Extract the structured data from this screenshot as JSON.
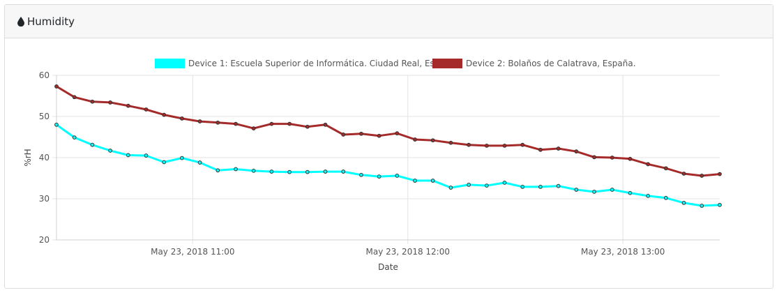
{
  "header": {
    "title": "Humidity",
    "icon": "droplet-icon"
  },
  "chart_data": {
    "type": "line",
    "title": "",
    "xlabel": "Date",
    "ylabel": "%rH",
    "ylim": [
      20,
      60
    ],
    "yticks": [
      "20",
      "30",
      "40",
      "50",
      "60"
    ],
    "xtick_labels": [
      "May 23, 2018 11:00",
      "May 23, 2018 12:00",
      "May 23, 2018 13:00"
    ],
    "grid": true,
    "legend_position": "top",
    "x": [
      "10:22",
      "10:27",
      "10:32",
      "10:37",
      "10:42",
      "10:47",
      "10:52",
      "10:57",
      "11:02",
      "11:07",
      "11:12",
      "11:17",
      "11:22",
      "11:27",
      "11:32",
      "11:37",
      "11:42",
      "11:47",
      "11:52",
      "11:57",
      "12:02",
      "12:07",
      "12:12",
      "12:17",
      "12:22",
      "12:27",
      "12:32",
      "12:37",
      "12:42",
      "12:47",
      "12:52",
      "12:57",
      "13:02",
      "13:07",
      "13:12",
      "13:17",
      "13:22",
      "13:27"
    ],
    "series": [
      {
        "name": "Device 1: Escuela Superior de Informática. Ciudad Real, España.",
        "color": "#00ffff",
        "values": [
          48.0,
          44.9,
          43.1,
          41.7,
          40.6,
          40.5,
          38.9,
          39.9,
          38.8,
          36.9,
          37.2,
          36.8,
          36.6,
          36.5,
          36.5,
          36.6,
          36.6,
          35.8,
          35.4,
          35.6,
          34.4,
          34.4,
          32.7,
          33.4,
          33.2,
          33.9,
          32.9,
          32.9,
          33.1,
          32.2,
          31.7,
          32.2,
          31.4,
          30.7,
          30.2,
          29.0,
          28.3,
          28.5
        ]
      },
      {
        "name": "Device 2: Bolaños de Calatrava, España.",
        "color": "#a52a2a",
        "values": [
          57.3,
          54.7,
          53.6,
          53.4,
          52.6,
          51.7,
          50.4,
          49.5,
          48.8,
          48.5,
          48.2,
          47.1,
          48.2,
          48.2,
          47.5,
          48.0,
          45.6,
          45.8,
          45.3,
          45.9,
          44.4,
          44.2,
          43.6,
          43.1,
          42.9,
          42.9,
          43.1,
          41.9,
          42.2,
          41.5,
          40.1,
          40.0,
          39.7,
          38.4,
          37.4,
          36.1,
          35.6,
          36.0
        ]
      }
    ]
  }
}
